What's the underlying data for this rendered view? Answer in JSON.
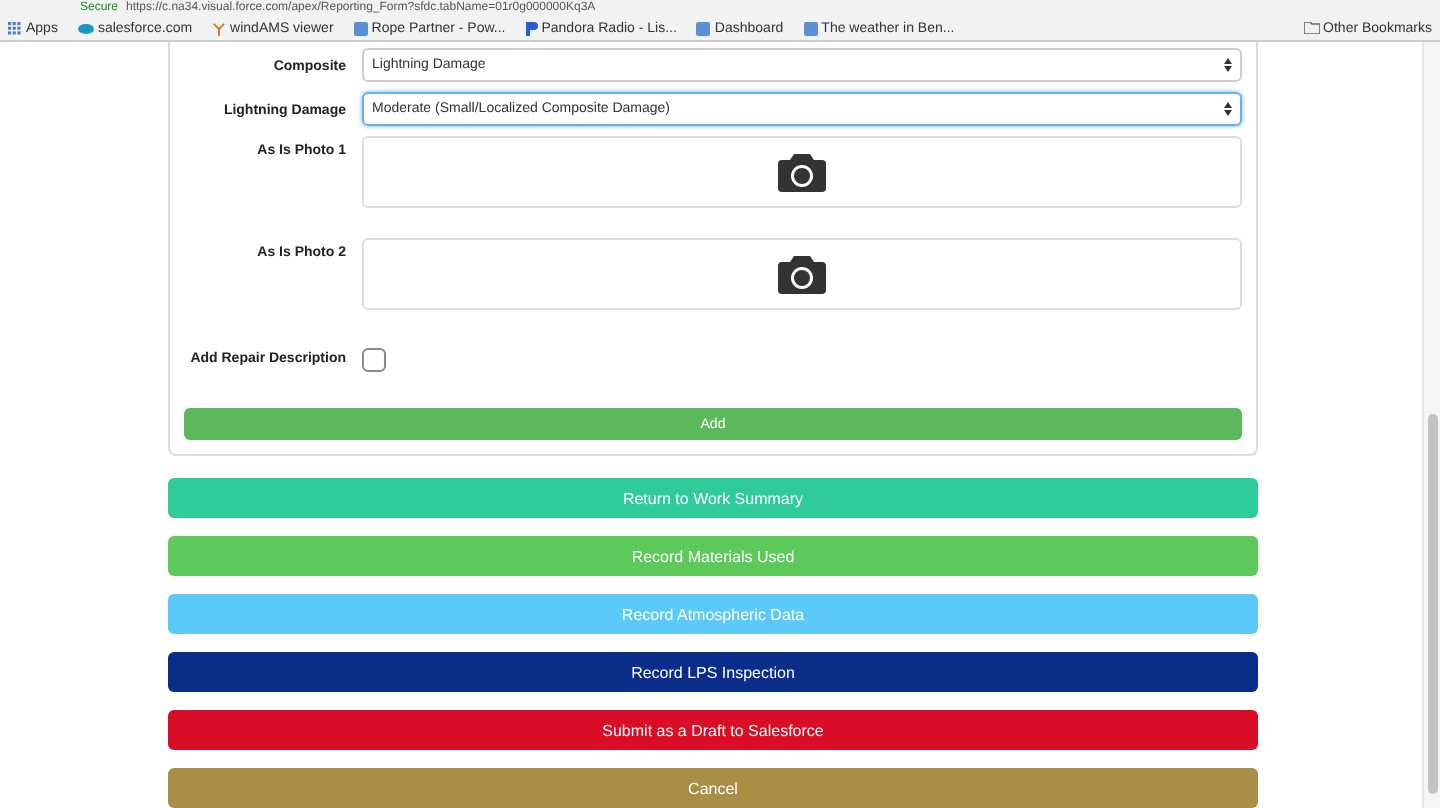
{
  "browser": {
    "security": "Secure",
    "url": "https://c.na34.visual.force.com/apex/Reporting_Form?sfdc.tabName=01r0g000000Kq3A",
    "bookmarks": [
      {
        "label": "Apps",
        "kind": "apps"
      },
      {
        "label": "salesforce.com",
        "kind": "cloud"
      },
      {
        "label": "windAMS viewer",
        "kind": "turbine"
      },
      {
        "label": "Rope Partner - Pow...",
        "kind": "page"
      },
      {
        "label": "Pandora Radio - Lis...",
        "kind": "flag"
      },
      {
        "label": "Dashboard",
        "kind": "page"
      },
      {
        "label": "The weather in Ben...",
        "kind": "page"
      }
    ],
    "other_bookmarks": "Other Bookmarks"
  },
  "form": {
    "fields": [
      {
        "kind": "select",
        "label": "Composite",
        "value": "Lightning Damage",
        "focused": false
      },
      {
        "kind": "select",
        "label": "Lightning Damage",
        "value": "Moderate (Small/Localized Composite Damage)",
        "focused": true
      },
      {
        "kind": "photo",
        "label": "As Is Photo 1"
      },
      {
        "kind": "photo",
        "label": "As Is Photo 2"
      },
      {
        "kind": "checkbox",
        "label": "Add Repair Description",
        "checked": false
      }
    ],
    "submit": "Add"
  },
  "actions": [
    {
      "label": "Return to Work Summary",
      "color": "#2fcb9b"
    },
    {
      "label": "Record Materials Used",
      "color": "#5dc95a"
    },
    {
      "label": "Record Atmospheric Data",
      "color": "#5ccaf8"
    },
    {
      "label": "Record LPS Inspection",
      "color": "#0b2d8a"
    },
    {
      "label": "Submit as a Draft to Salesforce",
      "color": "#d90d25"
    },
    {
      "label": "Cancel",
      "color": "#a88f45"
    }
  ]
}
